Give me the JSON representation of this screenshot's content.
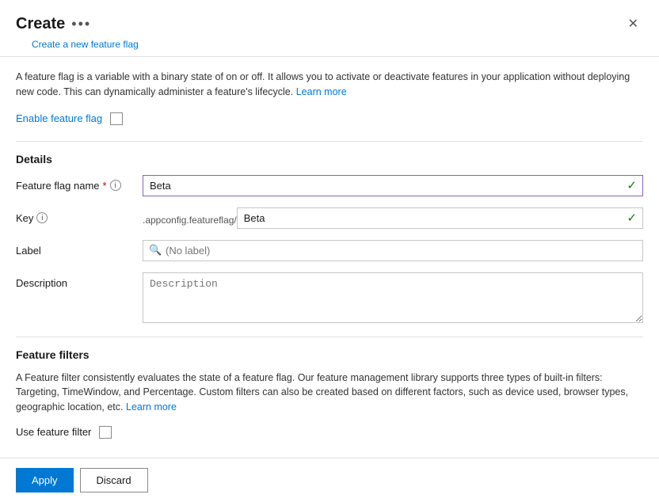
{
  "header": {
    "title": "Create",
    "subtitle": "Create a new feature flag",
    "more_icon": "•••",
    "close_icon": "✕"
  },
  "info": {
    "text_part1": "A feature flag is a variable with a binary state of on or off. It allows you to activate or deactivate features in your application without deploying new code. This can dynamically administer a feature's lifecycle.",
    "learn_more_label": "Learn more",
    "learn_more_url": "#"
  },
  "enable": {
    "label": "Enable feature flag"
  },
  "details": {
    "section_title": "Details",
    "flag_name_label": "Feature flag name",
    "flag_name_required": "*",
    "flag_name_value": "Beta",
    "key_label": "Key",
    "key_prefix": ".appconfig.featureflag/",
    "key_value": "Beta",
    "label_label": "Label",
    "label_placeholder": "(No label)",
    "description_label": "Description",
    "description_placeholder": "Description"
  },
  "feature_filters": {
    "section_title": "Feature filters",
    "info_text_part1": "A Feature filter consistently evaluates the state of a feature flag. Our feature management library supports three types of built-in filters: Targeting, TimeWindow, and Percentage. Custom filters can also be created based on different factors, such as device used, browser types, geographic location, etc.",
    "learn_more_label": "Learn more",
    "learn_more_url": "#",
    "use_filter_label": "Use feature filter"
  },
  "footer": {
    "apply_label": "Apply",
    "discard_label": "Discard"
  }
}
